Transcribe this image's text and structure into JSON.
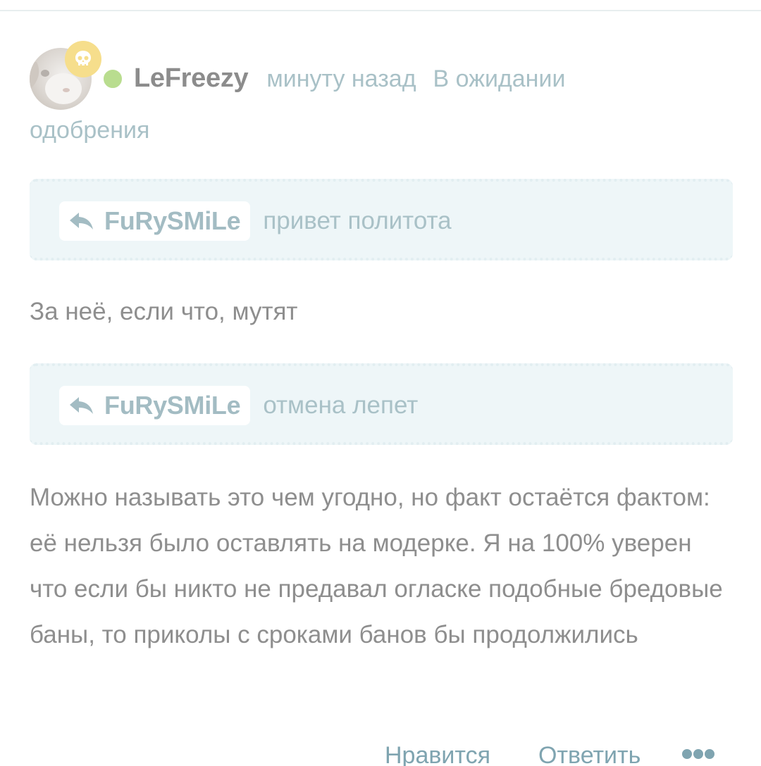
{
  "comment": {
    "username": "LeFreezy",
    "time": "минуту назад",
    "status_line1": "В ожидании",
    "status_line2": "одобрения",
    "avatar_alt": "avatar",
    "quotes": [
      {
        "author": "FuRySMiLe",
        "text": "привет политота"
      },
      {
        "author": "FuRySMiLe",
        "text": "отмена лепет"
      }
    ],
    "paragraphs": [
      "За неё, если что, мутят",
      "Можно называть это чем угодно, но факт остаётся фактом: её нельзя было оставлять на модерке. Я на 100% уверен что если бы никто не предавал огласке подобные бредовые баны, то приколы с сроками банов бы продолжились"
    ]
  },
  "actions": {
    "like_label": "Нравится",
    "reply_label": "Ответить",
    "more_icon": "more-dots-icon"
  },
  "icons": {
    "badge": "skull-icon",
    "reply": "reply-arrow-icon",
    "online": "online-status-dot"
  },
  "colors": {
    "username": "#8c8c8c",
    "meta": "#a9c1c7",
    "body_text": "#8e8e8e",
    "quote_bg": "#eef6f8",
    "reply_name": "#a3bcc3",
    "action": "#7fa4b0",
    "online_dot": "#b9dd8f",
    "badge_bg": "#f6de8c"
  }
}
